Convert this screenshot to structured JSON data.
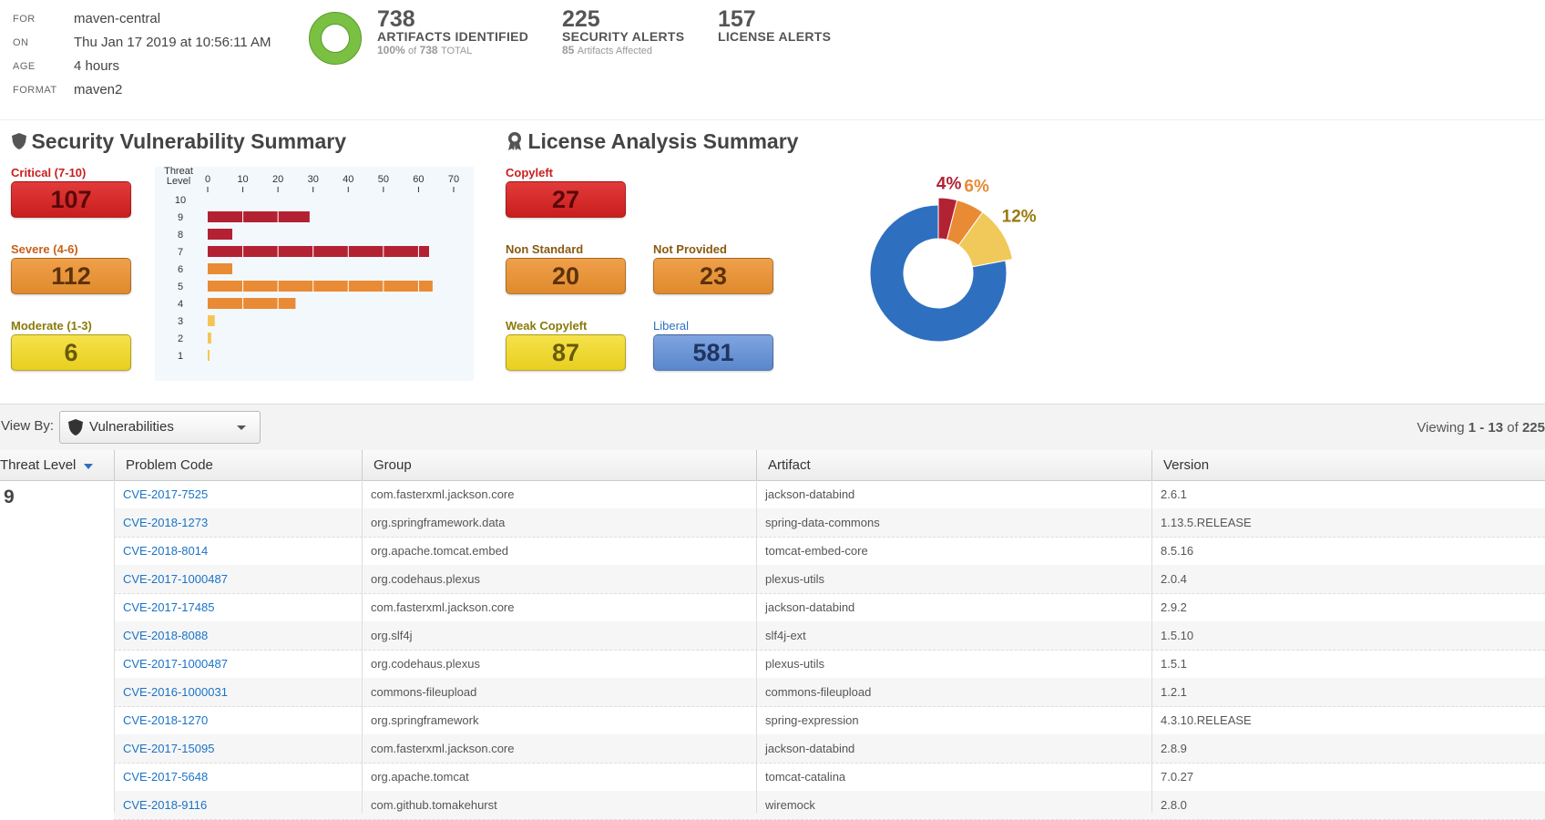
{
  "header": {
    "meta": [
      {
        "key": "FOR",
        "value": "maven-central"
      },
      {
        "key": "ON",
        "value": "Thu Jan 17 2019 at 10:56:11 AM"
      },
      {
        "key": "AGE",
        "value": "4 hours"
      },
      {
        "key": "FORMAT",
        "value": "maven2"
      }
    ],
    "identified": {
      "number": "738",
      "label": "ARTIFACTS IDENTIFIED",
      "sub_pct": "100%",
      "sub_of": "of",
      "sub_total": "738",
      "sub_total_word": "TOTAL",
      "progress": 1.0
    },
    "security": {
      "number": "225",
      "label": "SECURITY ALERTS",
      "sub_count": "85",
      "sub_text": "Artifacts Affected"
    },
    "license": {
      "number": "157",
      "label": "LICENSE ALERTS"
    }
  },
  "security_summary": {
    "title": "Security Vulnerability Summary",
    "categories": [
      {
        "label": "Critical (7-10)",
        "value": "107",
        "color": "#c91e1e"
      },
      {
        "label": "Severe (4-6)",
        "value": "112",
        "color": "#e07f1f"
      },
      {
        "label": "Moderate (1-3)",
        "value": "6",
        "color": "#8a7a08"
      }
    ]
  },
  "chart_data": [
    {
      "type": "bar",
      "orientation": "horizontal",
      "ylabel": "Threat Level",
      "categories": [
        "10",
        "9",
        "8",
        "7",
        "6",
        "5",
        "4",
        "3",
        "2",
        "1"
      ],
      "values": [
        0,
        29,
        7,
        63,
        7,
        64,
        25,
        2,
        1,
        0.5
      ],
      "colors": [
        "#b22233",
        "#b22233",
        "#b22233",
        "#b22233",
        "#e98b35",
        "#e98b35",
        "#e98b35",
        "#f5c454",
        "#f5c454",
        "#f5c454"
      ],
      "xlim": [
        0,
        70
      ],
      "xticks": [
        "0",
        "10",
        "20",
        "30",
        "40",
        "50",
        "60",
        "70"
      ]
    },
    {
      "type": "pie",
      "slices": [
        {
          "label": "4%",
          "value": 4,
          "color": "#b22233"
        },
        {
          "label": "6%",
          "value": 6,
          "color": "#e98b35"
        },
        {
          "label": "12%",
          "value": 12,
          "color": "#f0c95a"
        },
        {
          "label": "",
          "value": 78,
          "color": "#2e6fc0"
        }
      ]
    }
  ],
  "license_summary": {
    "title": "License Analysis Summary",
    "categories": [
      {
        "label": "Copyleft",
        "value": "27",
        "color": "#c91e1e"
      },
      {
        "label": "Non Standard",
        "value": "20",
        "color": "#8a5a10"
      },
      {
        "label": "Not Provided",
        "value": "23",
        "color": "#8a5a10"
      },
      {
        "label": "Weak Copyleft",
        "value": "87",
        "color": "#8a7a08"
      },
      {
        "label": "Liberal",
        "value": "581",
        "color": "#2e6fc0"
      }
    ]
  },
  "toolbar": {
    "view_by_label": "View By:",
    "select_value": "Vulnerabilities",
    "viewing_prefix": "Viewing",
    "viewing_range": "1 - 13",
    "viewing_of": "of",
    "viewing_total": "225"
  },
  "table": {
    "columns": [
      "Threat Level",
      "Problem Code",
      "Group",
      "Artifact",
      "Version"
    ],
    "group_threat": "9",
    "rows": [
      {
        "code": "CVE-2017-7525",
        "group": "com.fasterxml.jackson.core",
        "artifact": "jackson-databind",
        "version": "2.6.1"
      },
      {
        "code": "CVE-2018-1273",
        "group": "org.springframework.data",
        "artifact": "spring-data-commons",
        "version": "1.13.5.RELEASE"
      },
      {
        "code": "CVE-2018-8014",
        "group": "org.apache.tomcat.embed",
        "artifact": "tomcat-embed-core",
        "version": "8.5.16"
      },
      {
        "code": "CVE-2017-1000487",
        "group": "org.codehaus.plexus",
        "artifact": "plexus-utils",
        "version": "2.0.4"
      },
      {
        "code": "CVE-2017-17485",
        "group": "com.fasterxml.jackson.core",
        "artifact": "jackson-databind",
        "version": "2.9.2"
      },
      {
        "code": "CVE-2018-8088",
        "group": "org.slf4j",
        "artifact": "slf4j-ext",
        "version": "1.5.10"
      },
      {
        "code": "CVE-2017-1000487",
        "group": "org.codehaus.plexus",
        "artifact": "plexus-utils",
        "version": "1.5.1"
      },
      {
        "code": "CVE-2016-1000031",
        "group": "commons-fileupload",
        "artifact": "commons-fileupload",
        "version": "1.2.1"
      },
      {
        "code": "CVE-2018-1270",
        "group": "org.springframework",
        "artifact": "spring-expression",
        "version": "4.3.10.RELEASE"
      },
      {
        "code": "CVE-2017-15095",
        "group": "com.fasterxml.jackson.core",
        "artifact": "jackson-databind",
        "version": "2.8.9"
      },
      {
        "code": "CVE-2017-5648",
        "group": "org.apache.tomcat",
        "artifact": "tomcat-catalina",
        "version": "7.0.27"
      },
      {
        "code": "CVE-2018-9116",
        "group": "com.github.tomakehurst",
        "artifact": "wiremock",
        "version": "2.8.0"
      }
    ]
  }
}
